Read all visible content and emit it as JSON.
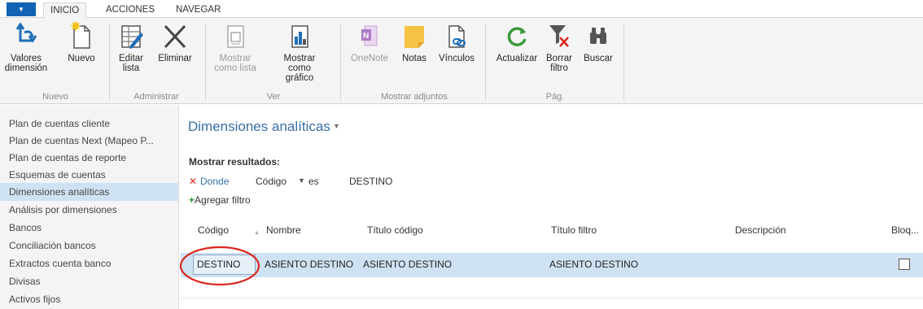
{
  "tabs": {
    "app_glyph": "▼",
    "inicio": "INICIO",
    "acciones": "ACCIONES",
    "navegar": "NAVEGAR"
  },
  "ribbon": {
    "valores_dimension": "Valores dimensión",
    "nuevo": "Nuevo",
    "editar_lista": "Editar lista",
    "eliminar": "Eliminar",
    "mostrar_como_lista": "Mostrar como lista",
    "mostrar_como_grafico": "Mostrar como gráfico",
    "onenote": "OneNote",
    "notas": "Notas",
    "vinculos": "Vínculos",
    "actualizar": "Actualizar",
    "borrar_filtro": "Borrar filtro",
    "buscar": "Buscar",
    "groups": {
      "nuevo": "Nuevo",
      "administrar": "Administrar",
      "ver": "Ver",
      "mostrar_adjuntos": "Mostrar adjuntos",
      "pag": "Pág."
    }
  },
  "nav": {
    "items": [
      "Plan de cuentas cliente",
      "Plan de cuentas Next (Mapeo P...",
      "Plan de cuentas de reporte",
      "Esquemas de cuentas",
      "Dimensiones analíticas",
      "Análisis por dimensiones",
      "Bancos",
      "Conciliación bancos",
      "Extractos cuenta banco",
      "Divisas",
      "Activos fijos"
    ],
    "selected_index": 4
  },
  "page": {
    "title": "Dimensiones analíticas"
  },
  "filter": {
    "heading": "Mostrar resultados:",
    "donde": "Donde",
    "field": "Código",
    "operator": "es",
    "value": "DESTINO",
    "add": "Agregar filtro"
  },
  "table": {
    "columns": [
      "Código",
      "Nombre",
      "Título código",
      "Título filtro",
      "Descripción",
      "Bloq..."
    ],
    "rows": [
      {
        "codigo": "DESTINO",
        "nombre": "ASIENTO DESTINO",
        "titulo_codigo": "ASIENTO DESTINO",
        "titulo_filtro": "ASIENTO DESTINO",
        "descripcion": "",
        "bloqueado": false
      }
    ]
  },
  "colors": {
    "accent": "#3570a6",
    "app_button": "#0f62b4",
    "selected_row": "#cfe2f3",
    "annotation": "#d9281e",
    "filter_remove": "#d9281e"
  }
}
